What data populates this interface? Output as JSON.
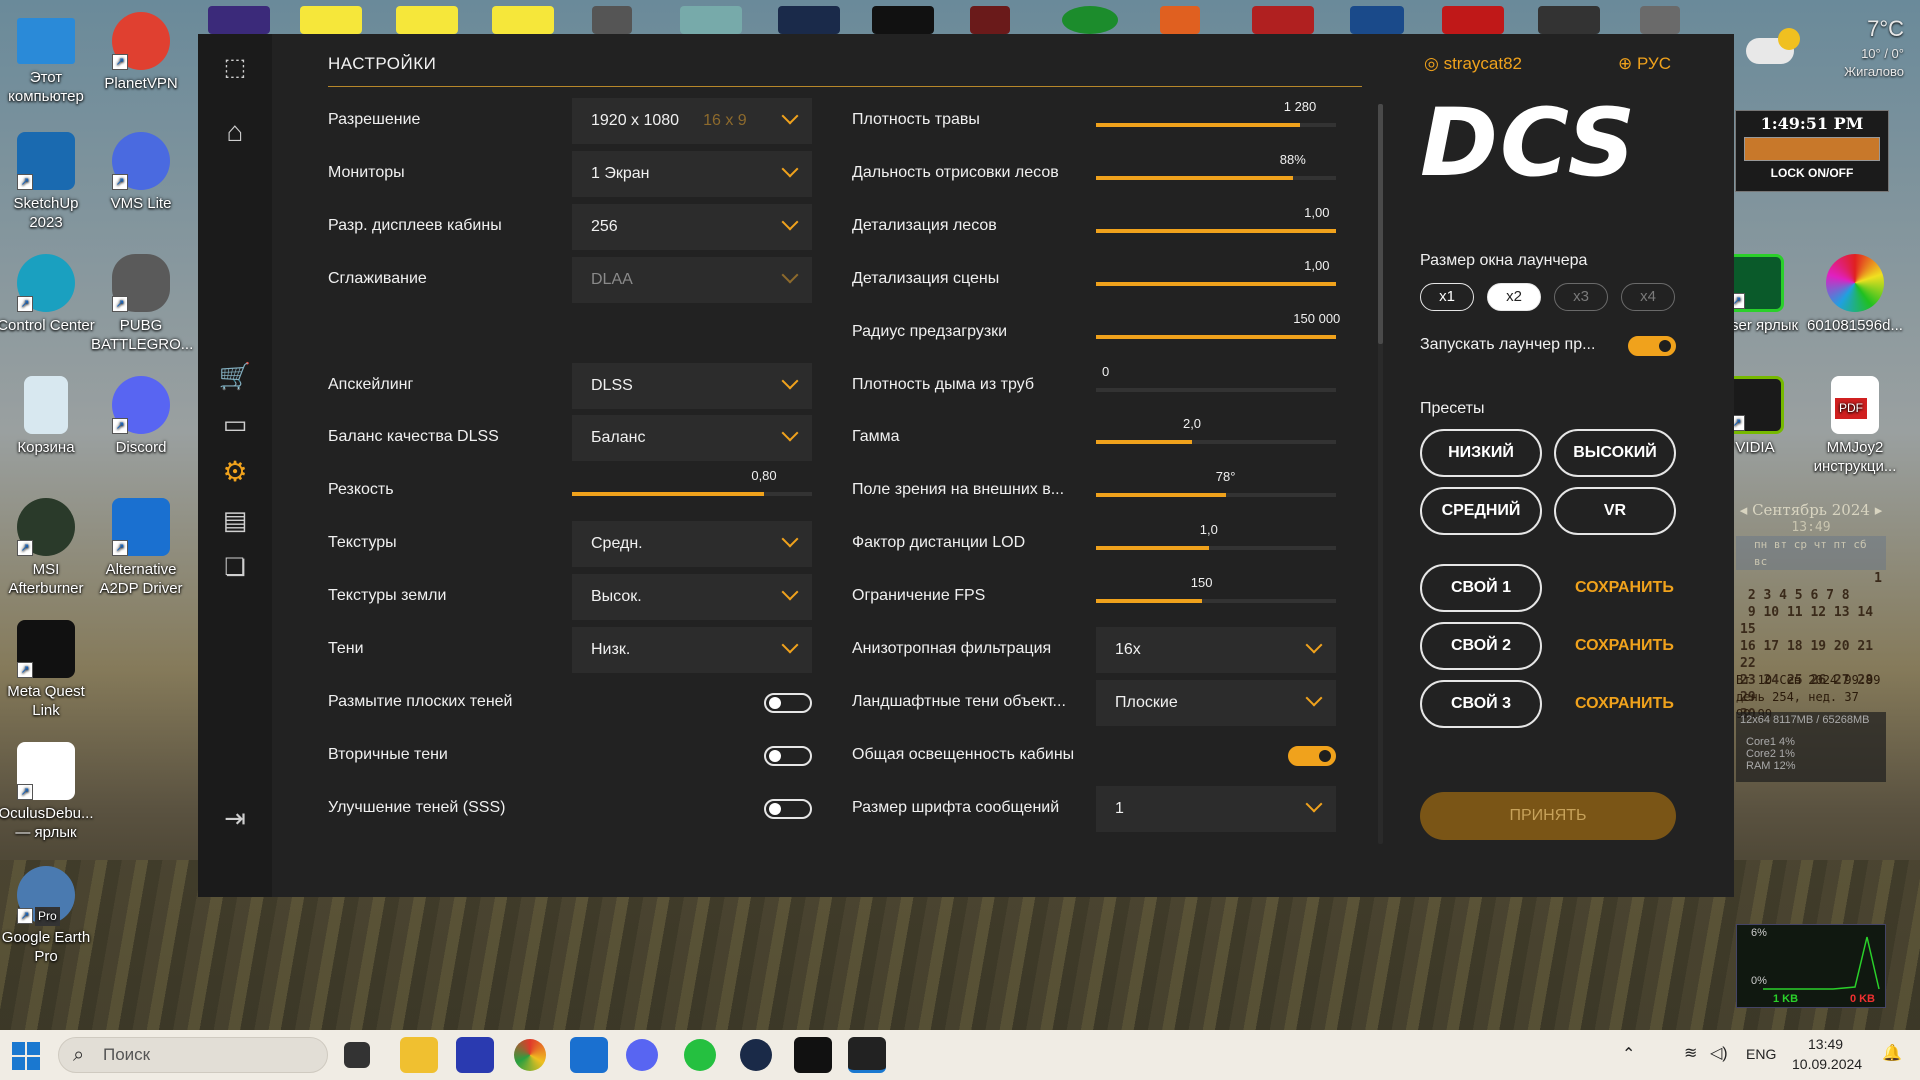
{
  "desktop": {
    "icons_left": [
      {
        "label": "Этот компьютер"
      },
      {
        "label": "SketchUp 2023"
      },
      {
        "label": "Control Center"
      },
      {
        "label": "Корзина"
      },
      {
        "label": "MSI Afterburner"
      },
      {
        "label": "Meta Quest Link"
      },
      {
        "label": "OculusDebu... — ярлык"
      },
      {
        "label": "Google Earth Pro"
      }
    ],
    "icons_left2": [
      {
        "label": "PlanetVPN"
      },
      {
        "label": "VMS Lite"
      },
      {
        "label": "PUBG BATTLEGRO..."
      },
      {
        "label": "Discord"
      },
      {
        "label": "Alternative A2DP Driver"
      }
    ],
    "icons_right": [
      {
        "label": "alyser ярлык"
      },
      {
        "label": "601081596d..."
      },
      {
        "label": "VIDIA"
      },
      {
        "label": "MMJoy2 инструкци..."
      }
    ],
    "pdf_badge": "PDF",
    "google_earth_badge": "Pro"
  },
  "launcher": {
    "title": "НАСТРОЙКИ",
    "user": "straycat82",
    "lang": "РУС",
    "logo": "DCS",
    "left_col": {
      "resolution": {
        "label": "Разрешение",
        "value": "1920 x 1080",
        "hint": "16 x 9"
      },
      "monitors": {
        "label": "Мониторы",
        "value": "1 Экран"
      },
      "cockpit_res": {
        "label": "Разр. дисплеев кабины",
        "value": "256"
      },
      "aa": {
        "label": "Сглаживание",
        "value": "DLAA"
      },
      "upscale": {
        "label": "Апскейлинг",
        "value": "DLSS"
      },
      "dlss_balance": {
        "label": "Баланс качества DLSS",
        "value": "Баланс"
      },
      "sharpness": {
        "label": "Резкость",
        "value": "0,80",
        "level": 0.8
      },
      "textures": {
        "label": "Текстуры",
        "value": "Средн."
      },
      "ground_textures": {
        "label": "Текстуры земли",
        "value": "Высок."
      },
      "shadows": {
        "label": "Тени",
        "value": "Низк."
      },
      "flat_shadow_blur": {
        "label": "Размытие плоских теней",
        "on": false
      },
      "secondary_shadows": {
        "label": "Вторичные тени",
        "on": false
      },
      "sss": {
        "label": "Улучшение теней (SSS)",
        "on": false
      }
    },
    "right_col": {
      "grass": {
        "label": "Плотность травы",
        "value": "1 280",
        "level": 0.85
      },
      "forest_dist": {
        "label": "Дальность отрисовки лесов",
        "value": "88%",
        "level": 0.82
      },
      "forest_detail": {
        "label": "Детализация лесов",
        "value": "1,00",
        "level": 1.0
      },
      "scene_detail": {
        "label": "Детализация сцены",
        "value": "1,00",
        "level": 1.0
      },
      "preload": {
        "label": "Радиус предзагрузки",
        "value": "150 000",
        "level": 1.0
      },
      "smoke": {
        "label": "Плотность дыма из труб",
        "value": "0",
        "level": 0.0
      },
      "gamma": {
        "label": "Гамма",
        "value": "2,0",
        "level": 0.4
      },
      "fov": {
        "label": "Поле зрения на внешних в...",
        "value": "78°",
        "level": 0.54
      },
      "lod": {
        "label": "Фактор дистанции LOD",
        "value": "1,0",
        "level": 0.47
      },
      "fps": {
        "label": "Ограничение FPS",
        "value": "150",
        "level": 0.44
      },
      "aniso": {
        "label": "Анизотропная фильтрация",
        "value": "16x"
      },
      "terrain_shadows": {
        "label": "Ландшафтные тени объект...",
        "value": "Плоские"
      },
      "cockpit_light": {
        "label": "Общая освещенность кабины",
        "on": true
      },
      "msg_font": {
        "label": "Размер шрифта сообщений",
        "value": "1"
      }
    },
    "right_panel": {
      "window_size_label": "Размер окна лаунчера",
      "sizes": [
        "x1",
        "x2",
        "x3",
        "x4"
      ],
      "selected_size": "x2",
      "autostart_label": "Запускать лаунчер пр...",
      "autostart_on": true,
      "presets_label": "Пресеты",
      "presets": [
        "НИЗКИЙ",
        "ВЫСОКИЙ",
        "СРЕДНИЙ",
        "VR"
      ],
      "custom": [
        "СВОЙ 1",
        "СВОЙ 2",
        "СВОЙ 3"
      ],
      "save": "СОХРАНИТЬ",
      "accept": "ПРИНЯТЬ"
    }
  },
  "widgets": {
    "weather_temp": "7°C",
    "weather_range": "10° / 0°",
    "weather_city": "Жигалово",
    "clock": "1:49:51 PM",
    "lock": "LOCK ON/OFF",
    "calendar_title": "Сентябрь 2024",
    "calendar_time": "13:49",
    "calendar_days": "пн вт ср чт пт сб вс",
    "calendar_footer1": "Вт 10 Сен 2024   99:99",
    "calendar_footer2": "день 254, нед. 37 99:99",
    "mem": "12x64  8117MB / 65268MB",
    "core1": "Core1  4%",
    "core2": "Core2  1%",
    "ram": "RAM  12%",
    "net_top": "6%",
    "net_bottom": "0%",
    "net_in": "1 KB",
    "net_out": "0 KB"
  },
  "taskbar": {
    "search_placeholder": "Поиск",
    "lang": "ENG",
    "time": "13:49",
    "date": "10.09.2024"
  },
  "colors": {
    "accent": "#f0a21c",
    "panel": "#222222"
  }
}
